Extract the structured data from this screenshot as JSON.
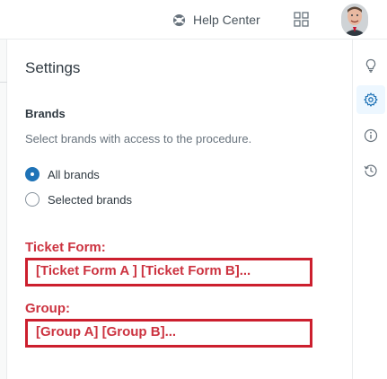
{
  "header": {
    "help_center_label": "Help Center",
    "help_icon": "lifebuoy-icon",
    "apps_icon": "apps-grid-icon",
    "avatar": "user-avatar"
  },
  "rail": {
    "items": [
      {
        "icon": "lightbulb-icon",
        "active": false
      },
      {
        "icon": "gear-icon",
        "active": true
      },
      {
        "icon": "info-icon",
        "active": false
      },
      {
        "icon": "history-icon",
        "active": false
      }
    ]
  },
  "settings": {
    "title": "Settings",
    "brands_label": "Brands",
    "brands_hint": "Select brands with access to the procedure.",
    "options": [
      {
        "label": "All brands",
        "checked": true
      },
      {
        "label": "Selected brands",
        "checked": false
      }
    ]
  },
  "annotations": {
    "ticket_form_label": "Ticket Form:",
    "ticket_form_value": "[Ticket Form A ] [Ticket Form B]...",
    "group_label": "Group:",
    "group_value": "[Group A] [Group B]..."
  },
  "colors": {
    "accent": "#1f73b7",
    "annotation_red": "#cc3340"
  }
}
